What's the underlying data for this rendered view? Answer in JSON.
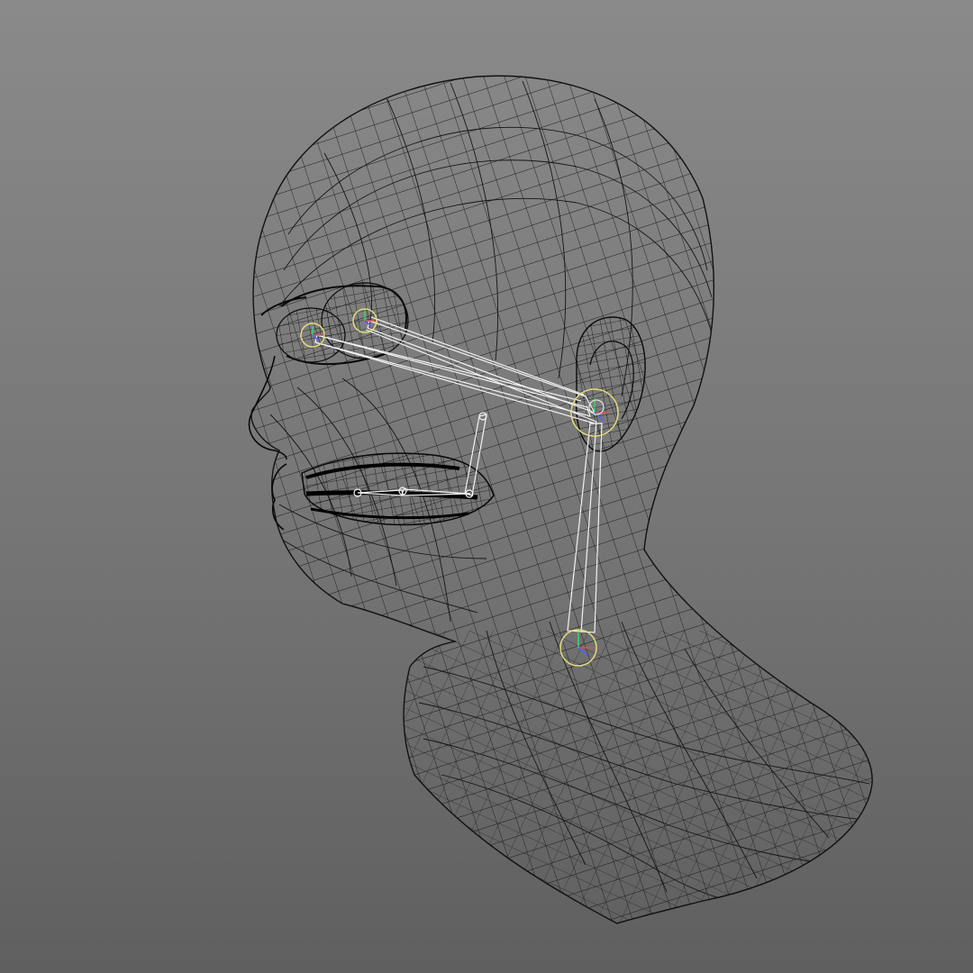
{
  "viewport": {
    "background_top": "#8a8a8a",
    "background_bottom": "#5f5f5f"
  },
  "mesh": {
    "display_mode": "wireframe",
    "subject": "head-and-neck",
    "wire_color": "#111111"
  },
  "rig": {
    "bone_color": "#f2f2f2",
    "joint_ring_color": "#e3dc7a",
    "axis_colors": [
      "#3fd46b",
      "#5a5aff",
      "#e05050"
    ],
    "joints": [
      "left-eye",
      "right-eye",
      "head-pivot",
      "neck-base",
      "jaw-tip",
      "jaw-mid",
      "jaw-hinge"
    ]
  }
}
